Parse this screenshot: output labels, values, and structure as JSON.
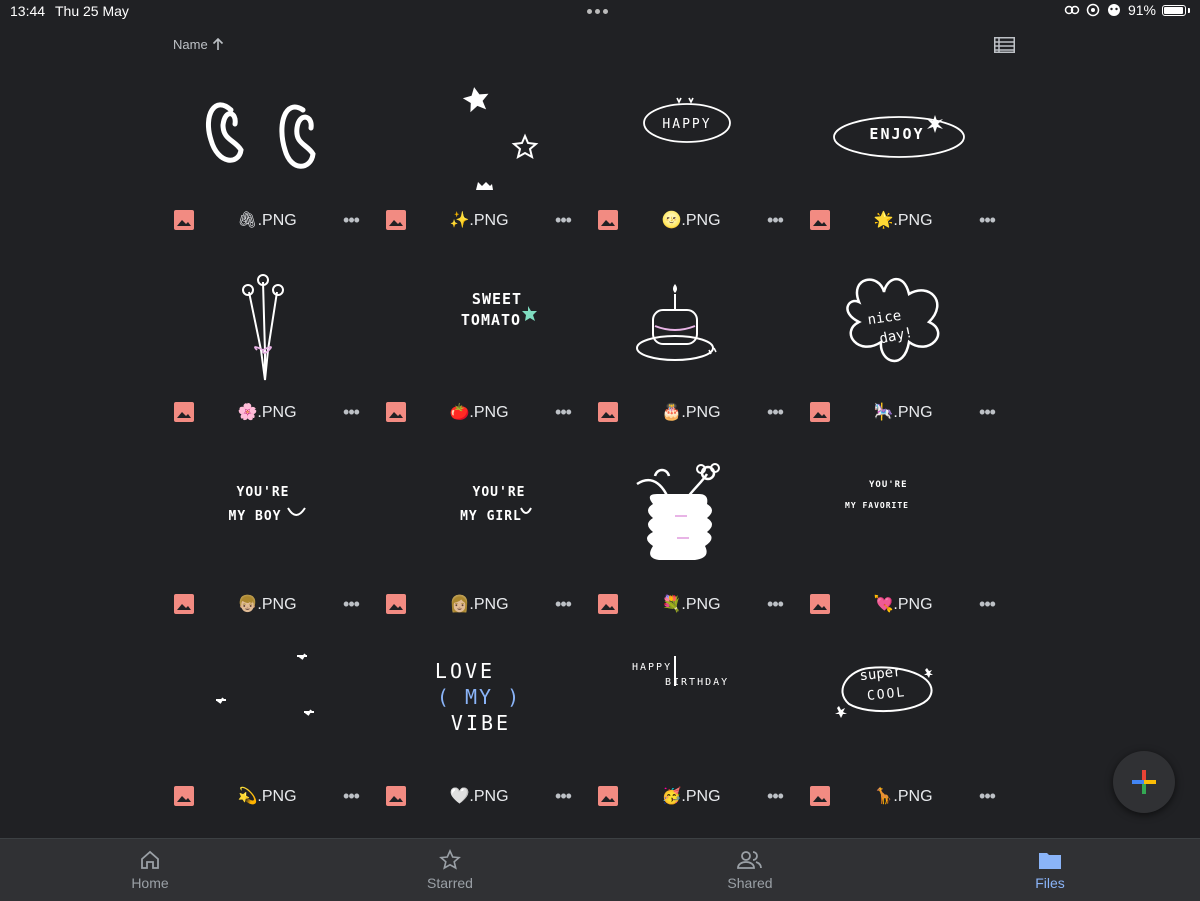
{
  "status": {
    "time": "13:44",
    "date": "Thu 25 May",
    "battery": "91%"
  },
  "sort": {
    "label": "Name"
  },
  "files": [
    {
      "name": "🖇.PNG"
    },
    {
      "name": "✨.PNG"
    },
    {
      "name": "🌝.PNG"
    },
    {
      "name": "🌟.PNG"
    },
    {
      "name": "🌸.PNG"
    },
    {
      "name": "🍅.PNG"
    },
    {
      "name": "🎂.PNG"
    },
    {
      "name": "🎠.PNG"
    },
    {
      "name": "👦🏼.PNG"
    },
    {
      "name": "👩🏼.PNG"
    },
    {
      "name": "💐.PNG"
    },
    {
      "name": "💘.PNG"
    },
    {
      "name": "💫.PNG"
    },
    {
      "name": "🤍.PNG"
    },
    {
      "name": "🥳.PNG"
    },
    {
      "name": "🦒.PNG"
    }
  ],
  "thumb_text": {
    "happy": "HAPPY",
    "enjoy": "ENJOY",
    "sweet": "SWEET",
    "tomato": "TOMATO",
    "nice": "nice",
    "day": "day!",
    "youre": "YOU'RE",
    "myboy": "MY BOY",
    "mygirl": "MY GIRL",
    "myfavorite": "MY FAVORITE",
    "love": "LOVE",
    "my": "( MY )",
    "vibe": "VIBE",
    "happy2": "HAPPY",
    "birthday": "BIRTHDAY",
    "super": "super",
    "cool": "COOL"
  },
  "nav": {
    "home": "Home",
    "starred": "Starred",
    "shared": "Shared",
    "files": "Files"
  },
  "colors": {
    "background": "#202124",
    "image_icon": "#f28b82",
    "active_nav": "#8ab4f8"
  }
}
